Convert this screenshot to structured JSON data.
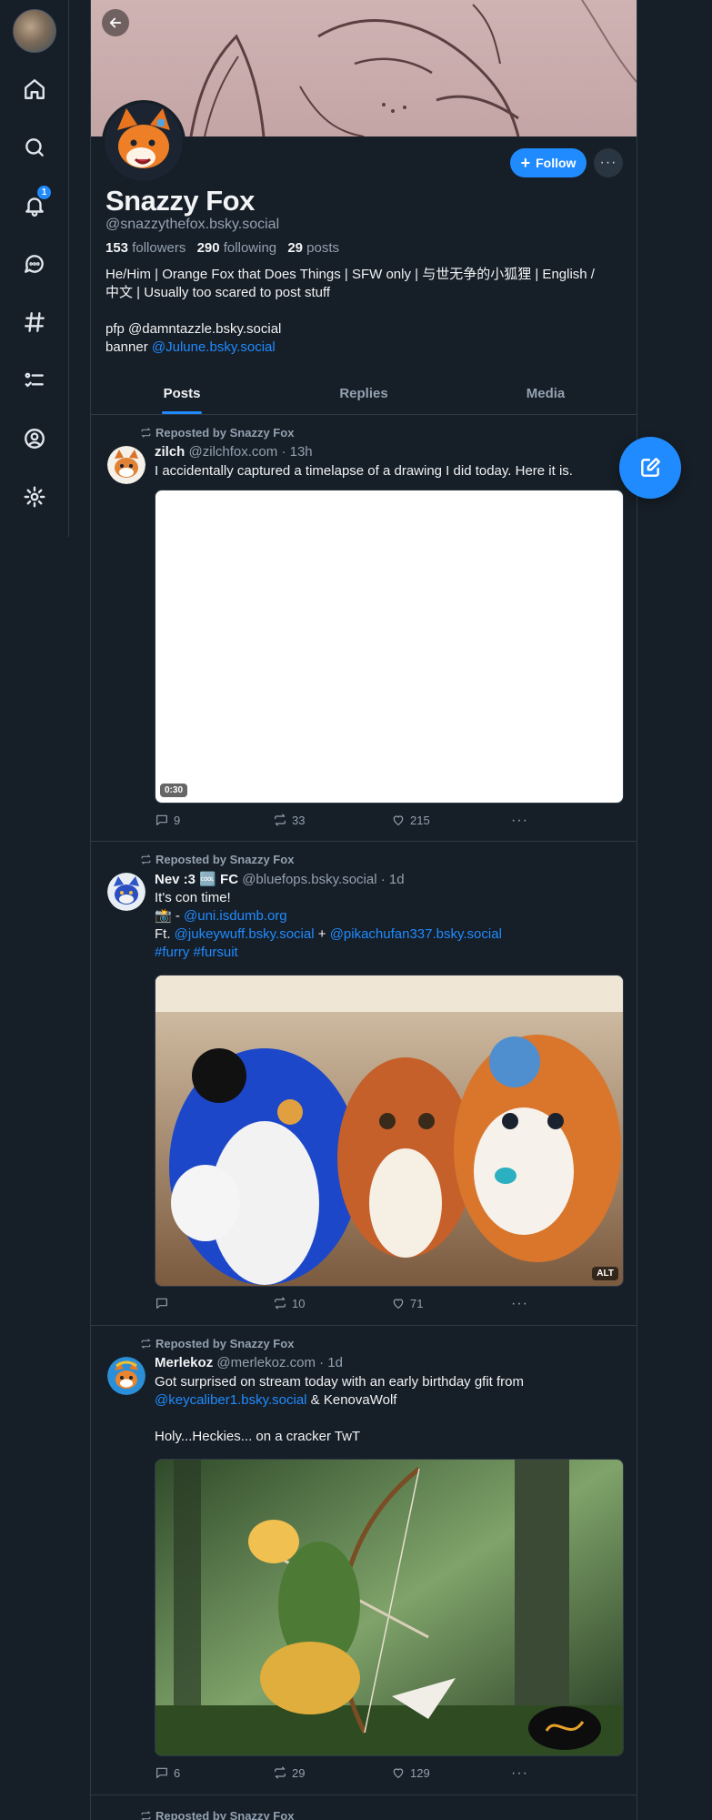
{
  "nav": {
    "notifications_count": "1",
    "items": [
      "home-icon",
      "search-icon",
      "bell-icon",
      "chat-icon",
      "hashtag-icon",
      "list-icon",
      "profile-icon",
      "gear-icon"
    ]
  },
  "profile": {
    "display_name": "Snazzy Fox",
    "handle": "@snazzythefox.bsky.social",
    "followers_count": "153",
    "followers_label": "followers",
    "following_count": "290",
    "following_label": "following",
    "posts_count": "29",
    "posts_label": "posts",
    "bio_line1": "He/Him | Orange Fox that Does Things | SFW only | 与世无争的小狐狸 | English /",
    "bio_line2": "中文 | Usually too scared to post stuff",
    "bio_pfp": "pfp @damntazzle.bsky.social",
    "bio_banner_prefix": "banner ",
    "bio_banner_link": "@Julune.bsky.social",
    "follow_label": "Follow",
    "more_label": "···"
  },
  "tabs": [
    "Posts",
    "Replies",
    "Media"
  ],
  "posts": [
    {
      "repost_label": "Reposted by Snazzy Fox",
      "author": "zilch",
      "handle": "@zilchfox.com",
      "time": "· 13h",
      "text": "I accidentally captured a timelapse of a drawing I did today. Here it is.",
      "media_badge": "0:30",
      "replies": "9",
      "reposts": "33",
      "likes": "215"
    },
    {
      "repost_label": "Reposted by Snazzy Fox",
      "author": "Nev :3 🆒 FC",
      "handle": "@bluefops.bsky.social",
      "time": "· 1d",
      "line1": "It's con time!",
      "line2_prefix": "📸 - ",
      "line2_link": "@uni.isdumb.org",
      "line3_prefix": "Ft. ",
      "line3_link1": "@jukeywuff.bsky.social",
      "line3_mid": " + ",
      "line3_link2": "@pikachufan337.bsky.social",
      "line4": "#furry #fursuit",
      "media_badge": "ALT",
      "replies": "",
      "reposts": "10",
      "likes": "71"
    },
    {
      "repost_label": "Reposted by Snazzy Fox",
      "author": "Merlekoz",
      "handle": "@merlekoz.com",
      "time": "· 1d",
      "line1": "Got surprised on stream today with an early birthday gfit from",
      "line2_link": "@keycaliber1.bsky.social",
      "line2_suffix": " & KenovaWolf",
      "line3": "Holy...Heckies... on a cracker TwT",
      "replies": "6",
      "reposts": "29",
      "likes": "129"
    },
    {
      "repost_label": "Reposted by Snazzy Fox"
    }
  ]
}
